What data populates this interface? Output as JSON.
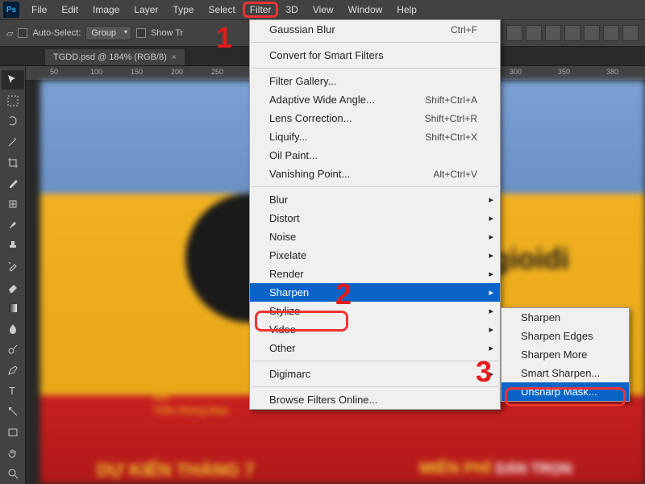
{
  "menubar": {
    "items": [
      "File",
      "Edit",
      "Image",
      "Layer",
      "Type",
      "Select",
      "Filter",
      "3D",
      "View",
      "Window",
      "Help"
    ],
    "highlighted_index": 6
  },
  "optbar": {
    "auto_select": "Auto-Select:",
    "group": "Group",
    "show": "Show Tr"
  },
  "doc_tab": {
    "title": "TGDD.psd @ 184% (RGB/8)",
    "close": "×"
  },
  "ruler_ticks": [
    "50",
    "100",
    "150",
    "200",
    "250",
    "300",
    "350",
    "300",
    "350",
    "380"
  ],
  "tools": [
    "move",
    "marquee",
    "lasso",
    "wand",
    "crop",
    "eyedrop",
    "heal",
    "brush",
    "stamp",
    "history",
    "eraser",
    "gradient",
    "blur",
    "dodge",
    "pen",
    "type",
    "path",
    "rect",
    "hand",
    "zoom"
  ],
  "filter_menu": {
    "last": {
      "label": "Gaussian Blur",
      "short": "Ctrl+F"
    },
    "smart": "Convert for Smart Filters",
    "g1": [
      {
        "label": "Filter Gallery...",
        "short": ""
      },
      {
        "label": "Adaptive Wide Angle...",
        "short": "Shift+Ctrl+A"
      },
      {
        "label": "Lens Correction...",
        "short": "Shift+Ctrl+R"
      },
      {
        "label": "Liquify...",
        "short": "Shift+Ctrl+X"
      },
      {
        "label": "Oil Paint...",
        "short": ""
      },
      {
        "label": "Vanishing Point...",
        "short": "Alt+Ctrl+V"
      }
    ],
    "g2": [
      "Blur",
      "Distort",
      "Noise",
      "Pixelate",
      "Render",
      "Sharpen",
      "Stylize",
      "Video",
      "Other"
    ],
    "g2_selected": 5,
    "digimarc": "Digimarc",
    "browse": "Browse Filters Online..."
  },
  "sub_menu": {
    "items": [
      "Sharpen",
      "Sharpen Edges",
      "Sharpen More",
      "Smart Sharpen...",
      "Unsharp Mask..."
    ],
    "selected": 4
  },
  "annotations": {
    "n1": "1",
    "n2": "2",
    "n3": "3"
  },
  "canvas": {
    "addr_num": "80",
    "addr_street": "Trần Hưng Đạo",
    "brand": "gioidi",
    "dukien": "DỰ KIẾN THÁNG 7",
    "mienphi": "MIỄN PHÍ",
    "dantron": "DÁN TRỌN"
  }
}
